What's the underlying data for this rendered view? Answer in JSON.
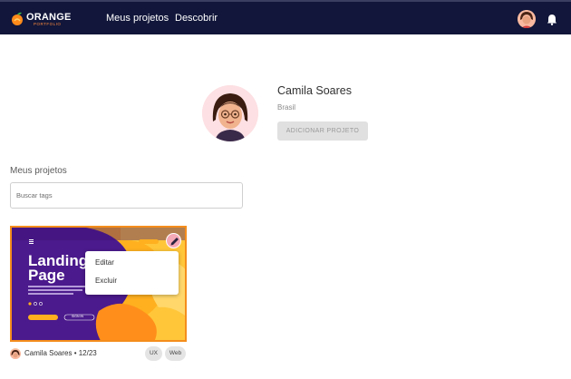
{
  "header": {
    "logo_text": "ORANGE",
    "logo_subtext": "PORTFOLIO",
    "nav": [
      {
        "label": "Meus projetos"
      },
      {
        "label": "Descobrir"
      }
    ]
  },
  "profile": {
    "name": "Camila Soares",
    "country": "Brasil",
    "add_project_label": "ADICIONAR PROJETO"
  },
  "projects_section": {
    "title": "Meus projetos",
    "search_placeholder": "Buscar tags"
  },
  "project_card": {
    "preview_title": "Landing Page",
    "preview_cta_label": "SIGN IN",
    "menu": {
      "edit_label": "Editar",
      "delete_label": "Excluir"
    },
    "author": "Camila Soares",
    "date": "12/23",
    "meta_text": "Camila Soares • 12/23",
    "tags": [
      "UX",
      "Web"
    ]
  },
  "colors": {
    "header_bg": "#11163a",
    "accent_orange": "#f48d1c",
    "preview_purple": "#4b1a8c",
    "disabled_button": "#e0e0e0"
  }
}
